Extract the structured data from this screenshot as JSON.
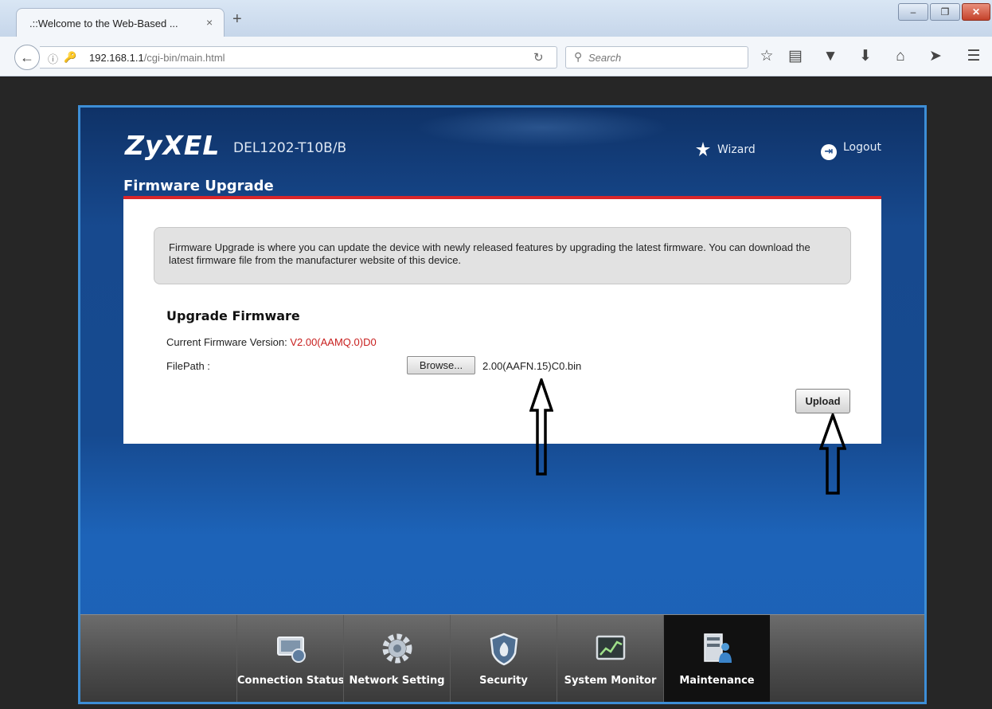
{
  "browser": {
    "tab_title": ".::Welcome to the Web-Based ...",
    "tab_close": "×",
    "new_tab": "+",
    "url_host": "192.168.1.1",
    "url_path": "/cgi-bin/main.html",
    "search_placeholder": "Search",
    "window_buttons": {
      "minimize": "–",
      "maximize": "❐",
      "close": "✕"
    },
    "toolbar_icons": [
      "star-icon",
      "reading-list-icon",
      "pocket-icon",
      "download-icon",
      "home-icon",
      "send-icon",
      "menu-icon"
    ]
  },
  "router": {
    "brand": "ZyXEL",
    "model": "DEL1202-T10B/B",
    "wizard_label": "Wizard",
    "logout_label": "Logout",
    "page_title": "Firmware Upgrade",
    "notice": "Firmware Upgrade is where you can update the device with newly released features by upgrading the latest firmware. You can download the latest firmware file from the manufacturer website of this device.",
    "section_title": "Upgrade Firmware",
    "current_fw_label": "Current Firmware Version: ",
    "current_fw_value": "V2.00(AAMQ.0)D0",
    "filepath_label": "FilePath :",
    "browse_label": "Browse...",
    "file_name": "2.00(AAFN.15)C0.bin",
    "upload_label": "Upload"
  },
  "bottom_nav": [
    {
      "label": "Connection Status",
      "icon": "connection-status-icon",
      "active": false
    },
    {
      "label": "Network Setting",
      "icon": "network-setting-gear-icon",
      "active": false
    },
    {
      "label": "Security",
      "icon": "security-shield-icon",
      "active": false
    },
    {
      "label": "System Monitor",
      "icon": "system-monitor-chart-icon",
      "active": false
    },
    {
      "label": "Maintenance",
      "icon": "maintenance-icon",
      "active": true
    }
  ],
  "colors": {
    "accent_red": "#d9262a",
    "firmware_version_red": "#c8201f",
    "frame_blue": "#3d8ed6",
    "panel_blue": "#164a90"
  }
}
